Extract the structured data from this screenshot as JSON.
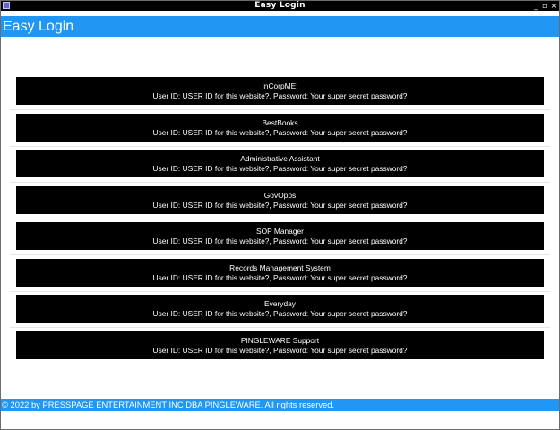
{
  "window": {
    "title": "Easy Login",
    "controls": [
      "_",
      "▫",
      "×"
    ]
  },
  "header": {
    "title": "Easy Login"
  },
  "entries": [
    {
      "name": "InCorpME!",
      "credentials": "User ID: USER ID for this website?, Password: Your super secret password?"
    },
    {
      "name": "BestBooks",
      "credentials": "User ID: USER ID for this website?, Password: Your super secret password?"
    },
    {
      "name": "Administrative Assistant",
      "credentials": "User ID: USER ID for this website?, Password: Your super secret password?"
    },
    {
      "name": "GovOpps",
      "credentials": "User ID: USER ID for this website?, Password: Your super secret password?"
    },
    {
      "name": "SOP Manager",
      "credentials": "User ID: USER ID for this website?, Password: Your super secret password?"
    },
    {
      "name": "Records Management System",
      "credentials": "User ID: USER ID for this website?, Password: Your super secret password?"
    },
    {
      "name": "Everyday",
      "credentials": "User ID: USER ID for this website?, Password: Your super secret password?"
    },
    {
      "name": "PINGLEWARE Support",
      "credentials": "User ID: USER ID for this website?, Password: Your super secret password?"
    }
  ],
  "footer": {
    "copyright": "© 2022 by PRESSPAGE ENTERTAINMENT INC DBA PINGLEWARE. All rights reserved."
  },
  "colors": {
    "accent": "#2196f3",
    "card_bg": "#000000",
    "card_text": "#ffffff"
  }
}
